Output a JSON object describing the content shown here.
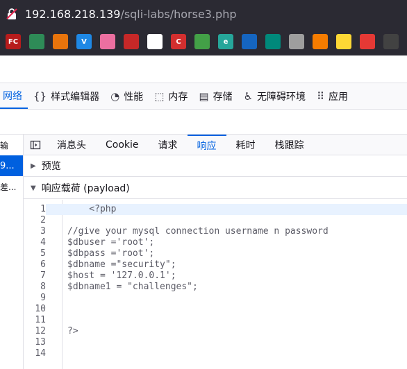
{
  "urlbar": {
    "host": "192.168.218.139",
    "path": "/sqli-labs/horse3.php"
  },
  "bookmarks": [
    {
      "name": "fc-icon",
      "label": "FC",
      "color": "#b71c1c"
    },
    {
      "name": "map-icon",
      "label": "",
      "color": "#2e8b57"
    },
    {
      "name": "hex-icon",
      "label": "",
      "color": "#e8740c"
    },
    {
      "name": "v-icon",
      "label": "V",
      "color": "#1e88e5"
    },
    {
      "name": "flower-icon",
      "label": "",
      "color": "#ec6fa0"
    },
    {
      "name": "badge-icon",
      "label": "",
      "color": "#c62828"
    },
    {
      "name": "github-icon",
      "label": "",
      "color": "#ffffff"
    },
    {
      "name": "c-icon",
      "label": "C",
      "color": "#d32f2f"
    },
    {
      "name": "grid-icon",
      "label": "",
      "color": "#43a047"
    },
    {
      "name": "e-icon",
      "label": "e",
      "color": "#26a69a"
    },
    {
      "name": "react-icon",
      "label": "",
      "color": "#1565c0"
    },
    {
      "name": "circle-icon",
      "label": "",
      "color": "#00897b"
    },
    {
      "name": "globe-icon",
      "label": "",
      "color": "#9e9e9e"
    },
    {
      "name": "bracket-icon",
      "label": "",
      "color": "#f57c00"
    },
    {
      "name": "face-icon",
      "label": "",
      "color": "#fdd835"
    },
    {
      "name": "red-square-icon",
      "label": "",
      "color": "#e53935"
    },
    {
      "name": "tool-icon",
      "label": "",
      "color": "#424242"
    }
  ],
  "devtools": {
    "tabs": [
      {
        "label": "网络",
        "icon": ""
      },
      {
        "label": "样式编辑器",
        "icon": "{}"
      },
      {
        "label": "性能",
        "icon": "◔"
      },
      {
        "label": "内存",
        "icon": "⬚"
      },
      {
        "label": "存储",
        "icon": "▤"
      },
      {
        "label": "无障碍环境",
        "icon": "♿"
      },
      {
        "label": "应用",
        "icon": "⠿"
      }
    ]
  },
  "left_column": [
    "输",
    "9...",
    "差..."
  ],
  "subtabs": [
    "消息头",
    "Cookie",
    "请求",
    "响应",
    "耗时",
    "栈跟踪"
  ],
  "sections": {
    "preview": "预览",
    "payload": "响应载荷 (payload)"
  },
  "code_lines": [
    {
      "n": "1",
      "text": "    <?php"
    },
    {
      "n": "2",
      "text": ""
    },
    {
      "n": "3",
      "text": "//give your mysql connection username n password"
    },
    {
      "n": "4",
      "text": "$dbuser ='root';"
    },
    {
      "n": "5",
      "text": "$dbpass ='root';"
    },
    {
      "n": "6",
      "text": "$dbname =\"security\";"
    },
    {
      "n": "7",
      "text": "$host = '127.0.0.1';"
    },
    {
      "n": "8",
      "text": "$dbname1 = \"challenges\";"
    },
    {
      "n": "9",
      "text": ""
    },
    {
      "n": "10",
      "text": ""
    },
    {
      "n": "11",
      "text": ""
    },
    {
      "n": "12",
      "text": "?>"
    },
    {
      "n": "13",
      "text": ""
    },
    {
      "n": "14",
      "text": ""
    }
  ]
}
